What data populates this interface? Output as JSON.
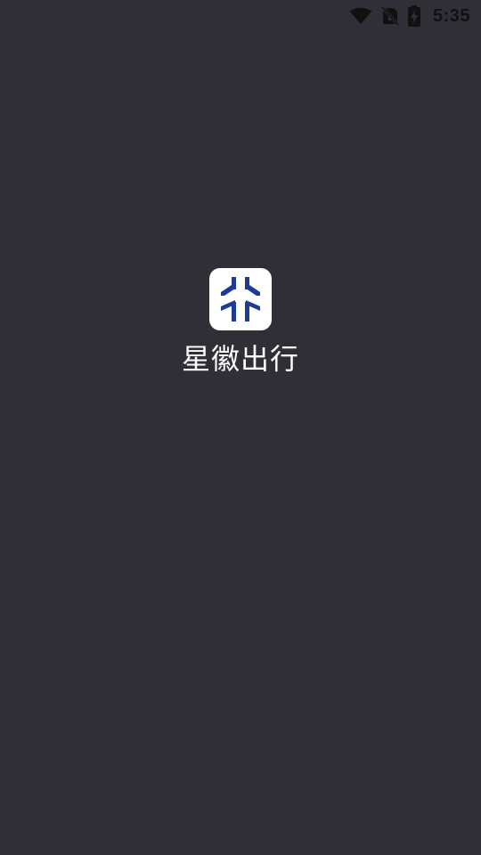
{
  "status_bar": {
    "time": "5:35",
    "icons": [
      "wifi-icon",
      "no-sim-icon",
      "battery-charging-icon"
    ]
  },
  "splash": {
    "app_name": "星徽出行",
    "logo_icon": "star-emblem-icon"
  },
  "colors": {
    "background": "#2f2f38",
    "logo_background": "#ffffff",
    "logo_mark": "#1f3a93",
    "status_icons": "#111111"
  }
}
